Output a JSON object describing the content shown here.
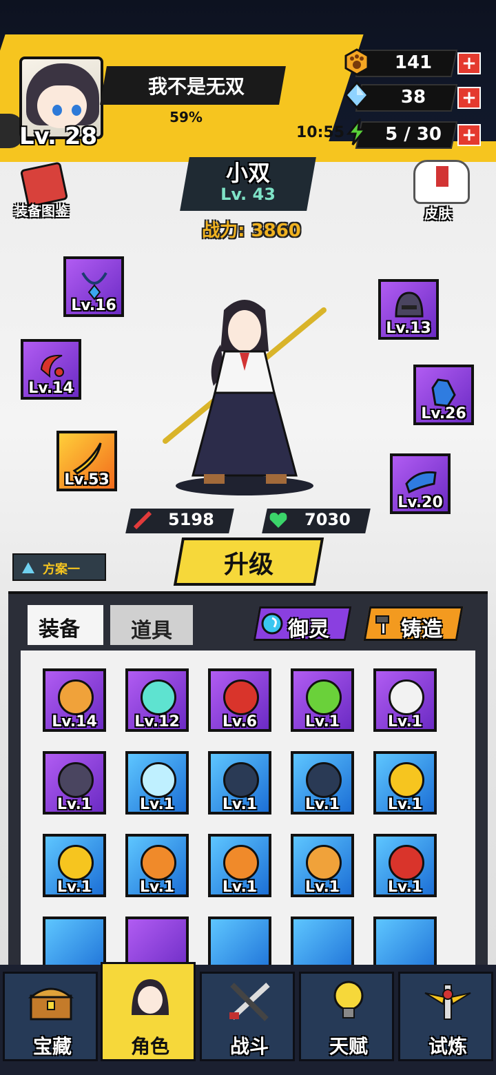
{
  "player": {
    "name": "我不是无双",
    "level_label": "Lv. 28",
    "exp_percent": "59%"
  },
  "resources": {
    "paw_coins": "141",
    "gems": "38",
    "stamina": "5 / 30",
    "stamina_timer": "10:55",
    "plus_symbol": "+"
  },
  "side_buttons": {
    "equipment_codex": "装备图鉴",
    "skin": "皮肤"
  },
  "hero": {
    "name": "小双",
    "level": "Lv. 43",
    "power": "战力: 3860",
    "attack": "5198",
    "health": "7030"
  },
  "equipped": [
    {
      "slot": "necklace",
      "level": "Lv.16"
    },
    {
      "slot": "helmet",
      "level": "Lv.13"
    },
    {
      "slot": "ring",
      "level": "Lv.14"
    },
    {
      "slot": "gloves",
      "level": "Lv.26"
    },
    {
      "slot": "weapon",
      "level": "Lv.53"
    },
    {
      "slot": "boots",
      "level": "Lv.20"
    }
  ],
  "plan_label": "方案一",
  "upgrade_label": "升级",
  "tabs": {
    "equipment": "装备",
    "items": "道具"
  },
  "features": {
    "spirit": "御灵",
    "forge": "铸造"
  },
  "inventory": [
    {
      "level": "Lv.14",
      "rarity": "purple",
      "icon": "orange-necklace"
    },
    {
      "level": "Lv.12",
      "rarity": "purple",
      "icon": "teal-pendant"
    },
    {
      "level": "Lv.6",
      "rarity": "purple",
      "icon": "red-scarf"
    },
    {
      "level": "Lv.1",
      "rarity": "purple",
      "icon": "green-blade"
    },
    {
      "level": "Lv.1",
      "rarity": "purple",
      "icon": "white-blade"
    },
    {
      "level": "Lv.1",
      "rarity": "purple",
      "icon": "helmet"
    },
    {
      "level": "Lv.1",
      "rarity": "blue",
      "icon": "light-sword"
    },
    {
      "level": "Lv.1",
      "rarity": "blue",
      "icon": "dark-blade"
    },
    {
      "level": "Lv.1",
      "rarity": "blue",
      "icon": "dark-blade"
    },
    {
      "level": "Lv.1",
      "rarity": "blue",
      "icon": "gold-ring"
    },
    {
      "level": "Lv.1",
      "rarity": "blue",
      "icon": "gold-ring"
    },
    {
      "level": "Lv.1",
      "rarity": "blue",
      "icon": "dragon-ring"
    },
    {
      "level": "Lv.1",
      "rarity": "blue",
      "icon": "dragon-ring"
    },
    {
      "level": "Lv.1",
      "rarity": "blue",
      "icon": "orange-necklace"
    },
    {
      "level": "Lv.1",
      "rarity": "blue",
      "icon": "red-scarf"
    }
  ],
  "nav": {
    "treasure": "宝藏",
    "character": "角色",
    "battle": "战斗",
    "talent": "天赋",
    "trial": "试炼"
  },
  "colors": {
    "accent_yellow": "#f6c51f",
    "epic_purple": "#8a3fe0",
    "rare_blue": "#2d8ee8",
    "plus_red": "#e43a2f"
  }
}
